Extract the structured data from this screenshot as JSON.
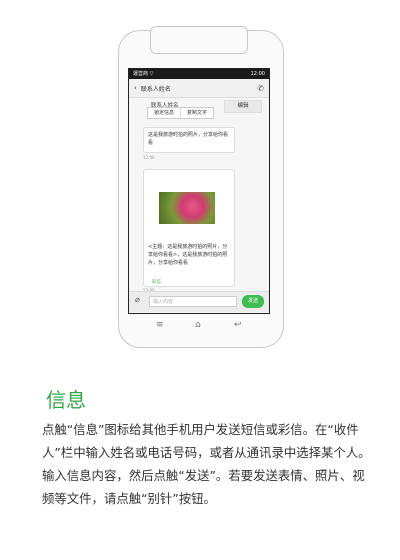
{
  "phone": {
    "status_left": "運営商 ▽",
    "status_right": "12:00",
    "contact_name": "联系人姓名",
    "contact_behind": "联系人姓名",
    "edit_label": "编辑",
    "popup_items": [
      "锁定信息",
      "复制文字"
    ],
    "message_1": "这是我旅游时拍的照片，分享给你看看",
    "timestamp_1": "12:00",
    "mms_text": "<主题：这是我旅游时拍的照片，分享给你看看>，这是我旅游时拍的照片，分享给你看看",
    "mms_label": "彩信",
    "timestamp_2": "12:00",
    "input_placeholder": "输入内容",
    "send_label": "发送",
    "icons": {
      "back": "back-arrow-icon",
      "call": "phone-call-icon",
      "attach": "paperclip-icon",
      "menu": "menu-icon",
      "home": "home-icon",
      "return": "return-icon"
    }
  },
  "content": {
    "heading": "信息",
    "description": "点触“信息”图标给其他手机用户发送短信或彩信。在“收件人”栏中输入姓名或电话号码，或者从通讯录中选择某个人。输入信息内容，然后点触“发送”。若要发送表情、照片、视频等文件，请点触“别针”按钮。"
  },
  "colors": {
    "accent": "#35a648",
    "send": "#3fbd52"
  }
}
